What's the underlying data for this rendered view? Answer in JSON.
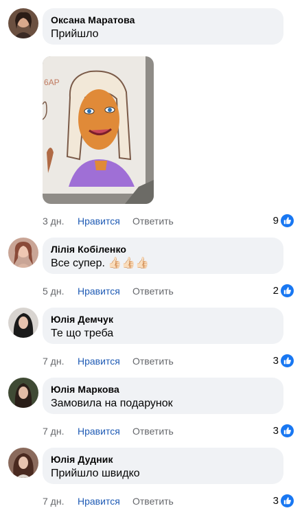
{
  "comments": [
    {
      "author": "Оксана Маратова",
      "text": "Прийшло",
      "time": "3 дн.",
      "like_label": "Нравится",
      "reply_label": "Ответить",
      "reactions": "9",
      "avatar_bg": "#7a5a48",
      "has_photo": true
    },
    {
      "author": "Лілія Кобіленко",
      "text": "Все супер. 👍🏻👍🏻👍🏻",
      "time": "5 дн.",
      "like_label": "Нравится",
      "reply_label": "Ответить",
      "reactions": "2",
      "avatar_bg": "#b98a7a"
    },
    {
      "author": "Юлія Демчук",
      "text": "Те що треба",
      "time": "7 дн.",
      "like_label": "Нравится",
      "reply_label": "Ответить",
      "reactions": "3",
      "avatar_bg": "#2a2a2a"
    },
    {
      "author": "Юлія Маркова",
      "text": "Замовила на подарунок",
      "time": "7 дн.",
      "like_label": "Нравится",
      "reply_label": "Ответить",
      "reactions": "3",
      "avatar_bg": "#4a4f3a"
    },
    {
      "author": "Юлія Дудник",
      "text": "Прийшло швидко",
      "time": "7 дн.",
      "like_label": "Нравится",
      "reply_label": "Ответить",
      "reactions": "3",
      "avatar_bg": "#6a4a40"
    }
  ],
  "colors": {
    "like_link": "#1f5bb5",
    "bubble": "#f0f2f5",
    "reaction_blue": "#1877f2"
  }
}
